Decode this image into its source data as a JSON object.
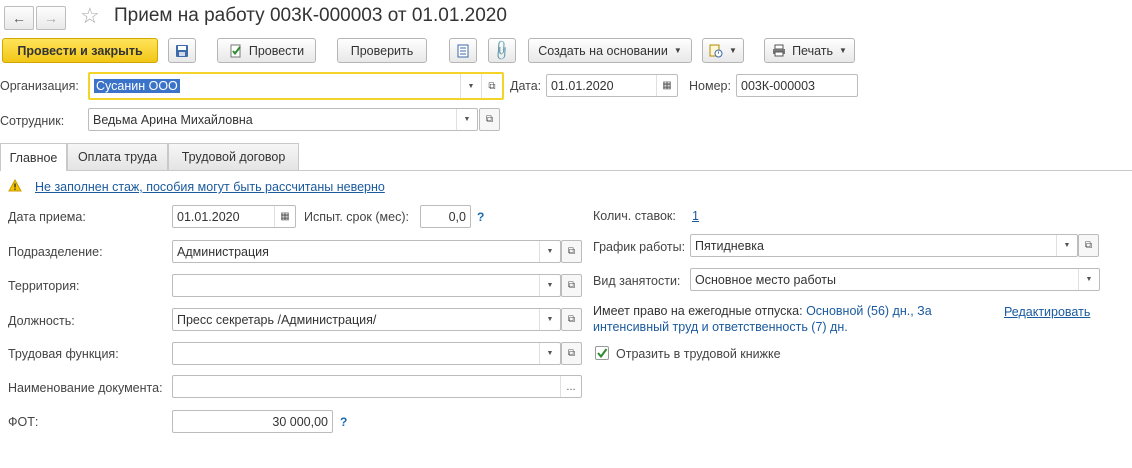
{
  "window": {
    "title": "Прием на работу 003К-000003 от 01.01.2020"
  },
  "toolbar": {
    "post_close_label": "Провести и закрыть",
    "post_label": "Провести",
    "check_label": "Проверить",
    "create_based_label": "Создать на основании",
    "print_label": "Печать"
  },
  "header": {
    "org_label": "Организация:",
    "org_value": "Сусанин ООО",
    "date_label": "Дата:",
    "date_value": "01.01.2020",
    "number_label": "Номер:",
    "number_value": "003К-000003",
    "employee_label": "Сотрудник:",
    "employee_value": "Ведьма Арина Михайловна"
  },
  "tabs": [
    {
      "label": "Главное"
    },
    {
      "label": "Оплата труда"
    },
    {
      "label": "Трудовой договор"
    }
  ],
  "main": {
    "warning_text": "Не заполнен стаж, пособия могут быть рассчитаны неверно",
    "hire_date_label": "Дата приема:",
    "hire_date_value": "01.01.2020",
    "probation_label": "Испыт. срок (мес):",
    "probation_value": "0,0",
    "question_mark": "?",
    "department_label": "Подразделение:",
    "department_value": "Администрация",
    "territory_label": "Территория:",
    "territory_value": "",
    "position_label": "Должность:",
    "position_value": "Пресс секретарь /Администрация/",
    "labor_function_label": "Трудовая функция:",
    "labor_function_value": "",
    "doc_name_label": "Наименование документа:",
    "doc_name_value": "",
    "doc_name_button": "...",
    "fot_label": "ФОТ:",
    "fot_value": "30 000,00",
    "rates_label": "Колич. ставок:",
    "rates_value": "1",
    "schedule_label": "График работы:",
    "schedule_value": "Пятидневка",
    "employment_label": "Вид занятости:",
    "employment_value": "Основное место работы",
    "vacation_label": "Имеет право на ежегодные отпуска:",
    "vacation_line1": "Основной (56) дн., За",
    "vacation_line2": "интенсивный труд и ответственность (7) дн.",
    "edit_link": "Редактировать",
    "reflect_label": "Отразить в трудовой книжке",
    "reflect_checked": true
  },
  "colors": {
    "accent_yellow": "#f5d42a",
    "link_blue": "#1a5a9e",
    "selection_blue": "#3b73c8",
    "warning_yellow": "#f5c400",
    "check_green": "#2e8b2e"
  }
}
